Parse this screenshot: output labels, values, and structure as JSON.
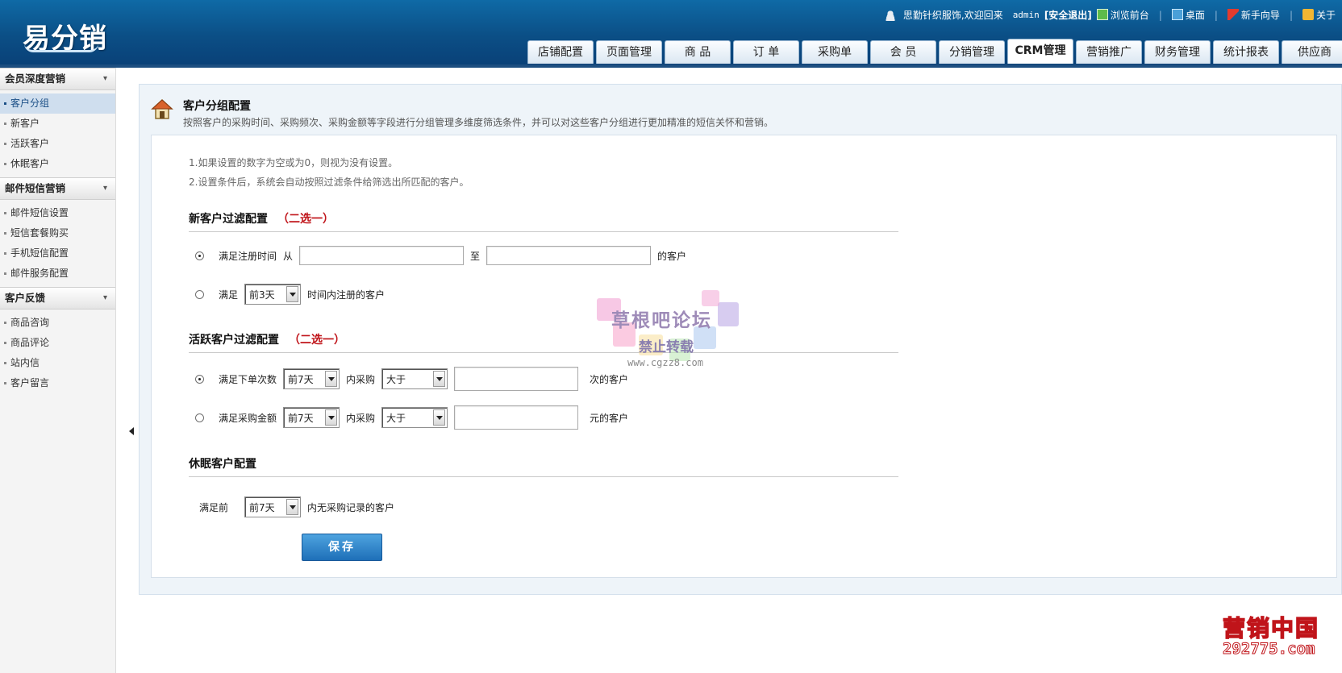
{
  "app": {
    "logo_text": "易分销",
    "colors": {
      "header": "#0b4f86",
      "accent": "#1e6fb8",
      "warn": "#c0141a",
      "panel_bg": "#eef4f9"
    }
  },
  "top_links": {
    "welcome": "思勤针织服饰,欢迎回来",
    "username": "admin",
    "logout": "[安全退出]",
    "browse_front": "浏览前台",
    "desktop": "桌面",
    "newbie_guide": "新手向导",
    "about": "关于"
  },
  "tabs": [
    {
      "label": "店铺配置"
    },
    {
      "label": "页面管理"
    },
    {
      "label": "商 品"
    },
    {
      "label": "订 单"
    },
    {
      "label": "采购单"
    },
    {
      "label": "会 员"
    },
    {
      "label": "分销管理"
    },
    {
      "label": "CRM管理",
      "active": true
    },
    {
      "label": "营销推广"
    },
    {
      "label": "财务管理"
    },
    {
      "label": "统计报表"
    },
    {
      "label": "供应商"
    }
  ],
  "sidebar": {
    "groups": [
      {
        "title": "会员深度营销",
        "items": [
          {
            "label": "客户分组"
          },
          {
            "label": "新客户"
          },
          {
            "label": "活跃客户"
          },
          {
            "label": "休眠客户"
          }
        ]
      },
      {
        "title": "邮件短信营销",
        "items": [
          {
            "label": "邮件短信设置"
          },
          {
            "label": "短信套餐购买"
          },
          {
            "label": "手机短信配置"
          },
          {
            "label": "邮件服务配置"
          }
        ]
      },
      {
        "title": "客户反馈",
        "items": [
          {
            "label": "商品咨询"
          },
          {
            "label": "商品评论"
          },
          {
            "label": "站内信"
          },
          {
            "label": "客户留言"
          }
        ]
      }
    ]
  },
  "page": {
    "title": "客户分组配置",
    "description": "按照客户的采购时间、采购频次、采购金额等字段进行分组管理多维度筛选条件，并可以对这些客户分组进行更加精准的短信关怀和营销。",
    "notes": [
      "1.如果设置的数字为空或为0，则视为没有设置。",
      "2.设置条件后，系统会自动按照过滤条件给筛选出所匹配的客户。"
    ]
  },
  "new_customer": {
    "title": "新客户过滤配置",
    "pick_one": "（二选一）",
    "opt1_label": "满足注册时间",
    "opt1_from": "从",
    "opt1_from_value": "",
    "opt1_to": "至",
    "opt1_to_value": "",
    "opt1_suffix": "的客户",
    "opt2_label": "满足",
    "opt2_select": "前3天",
    "opt2_suffix": "时间内注册的客户"
  },
  "active_customer": {
    "title": "活跃客户过滤配置",
    "pick_one": "（二选一）",
    "opt1_label": "满足下单次数",
    "opt1_period": "前7天",
    "opt1_mid": "内采购",
    "opt1_compare": "大于",
    "opt1_value": "",
    "opt1_suffix": "次的客户",
    "opt2_label": "满足采购金额",
    "opt2_period": "前7天",
    "opt2_mid": "内采购",
    "opt2_compare": "大于",
    "opt2_value": "",
    "opt2_suffix": "元的客户"
  },
  "dormant_customer": {
    "title": "休眠客户配置",
    "label": "满足前",
    "period": "前7天",
    "suffix": "内无采购记录的客户"
  },
  "save_label": "保存",
  "watermarks": {
    "center_line1": "草根吧论坛",
    "center_line2": "禁止转载",
    "center_line3": "www.cgzz8.com",
    "corner_line1": "营销中国",
    "corner_line2": "292775.com"
  }
}
